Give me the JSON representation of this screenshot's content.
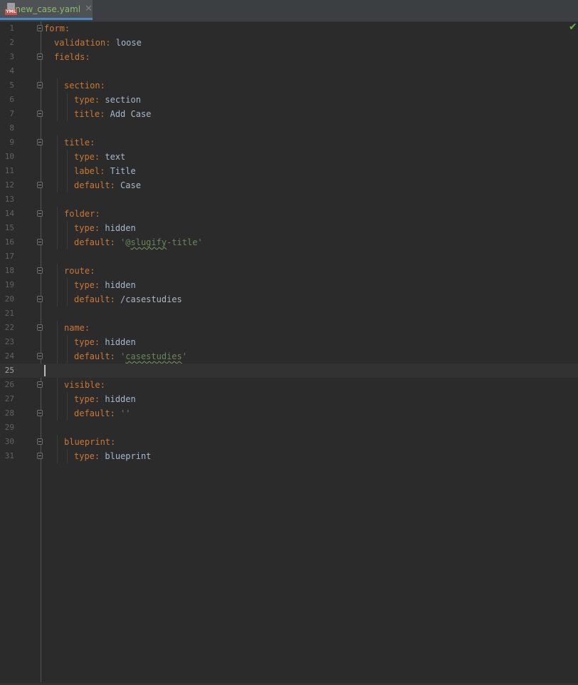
{
  "tab": {
    "title": "new_case.yaml",
    "icon_badge": "YML",
    "close_glyph": "✕"
  },
  "editor": {
    "inspection_status": "✔",
    "current_line": 25,
    "lines": [
      {
        "n": "1",
        "indent": 0,
        "key": "form",
        "val": "",
        "fold": true
      },
      {
        "n": "2",
        "indent": 1,
        "key": "validation",
        "val": "loose",
        "fold": false
      },
      {
        "n": "3",
        "indent": 1,
        "key": "fields",
        "val": "",
        "fold": true
      },
      {
        "n": "4",
        "indent": 0,
        "key": "",
        "val": "",
        "fold": false
      },
      {
        "n": "5",
        "indent": 2,
        "key": "section",
        "val": "",
        "fold": true
      },
      {
        "n": "6",
        "indent": 3,
        "key": "type",
        "val": "section",
        "fold": false
      },
      {
        "n": "7",
        "indent": 3,
        "key": "title",
        "val": "Add Case",
        "fold": true
      },
      {
        "n": "8",
        "indent": 0,
        "key": "",
        "val": "",
        "fold": false
      },
      {
        "n": "9",
        "indent": 2,
        "key": "title",
        "val": "",
        "fold": true
      },
      {
        "n": "10",
        "indent": 3,
        "key": "type",
        "val": "text",
        "fold": false
      },
      {
        "n": "11",
        "indent": 3,
        "key": "label",
        "val": "Title",
        "fold": false
      },
      {
        "n": "12",
        "indent": 3,
        "key": "default",
        "val": "Case",
        "fold": true
      },
      {
        "n": "13",
        "indent": 0,
        "key": "",
        "val": "",
        "fold": false
      },
      {
        "n": "14",
        "indent": 2,
        "key": "folder",
        "val": "",
        "fold": true
      },
      {
        "n": "15",
        "indent": 3,
        "key": "type",
        "val": "hidden",
        "fold": false
      },
      {
        "n": "16",
        "indent": 3,
        "key": "default",
        "val": "'@slugify-title'",
        "str": true,
        "squig": "slugify",
        "fold": true
      },
      {
        "n": "17",
        "indent": 0,
        "key": "",
        "val": "",
        "fold": false
      },
      {
        "n": "18",
        "indent": 2,
        "key": "route",
        "val": "",
        "fold": true
      },
      {
        "n": "19",
        "indent": 3,
        "key": "type",
        "val": "hidden",
        "fold": false
      },
      {
        "n": "20",
        "indent": 3,
        "key": "default",
        "val": "/casestudies",
        "fold": true
      },
      {
        "n": "21",
        "indent": 0,
        "key": "",
        "val": "",
        "fold": false
      },
      {
        "n": "22",
        "indent": 2,
        "key": "name",
        "val": "",
        "fold": true
      },
      {
        "n": "23",
        "indent": 3,
        "key": "type",
        "val": "hidden",
        "fold": false
      },
      {
        "n": "24",
        "indent": 3,
        "key": "default",
        "val": "'casestudies'",
        "str": true,
        "squig": "casestudies",
        "fold": true
      },
      {
        "n": "25",
        "indent": 0,
        "key": "",
        "val": "",
        "fold": false
      },
      {
        "n": "26",
        "indent": 2,
        "key": "visible",
        "val": "",
        "fold": true
      },
      {
        "n": "27",
        "indent": 3,
        "key": "type",
        "val": "hidden",
        "fold": false
      },
      {
        "n": "28",
        "indent": 3,
        "key": "default",
        "val": "''",
        "str": true,
        "fold": true
      },
      {
        "n": "29",
        "indent": 0,
        "key": "",
        "val": "",
        "fold": false
      },
      {
        "n": "30",
        "indent": 2,
        "key": "blueprint",
        "val": "",
        "fold": true
      },
      {
        "n": "31",
        "indent": 3,
        "key": "type",
        "val": "blueprint",
        "fold": true
      }
    ]
  }
}
